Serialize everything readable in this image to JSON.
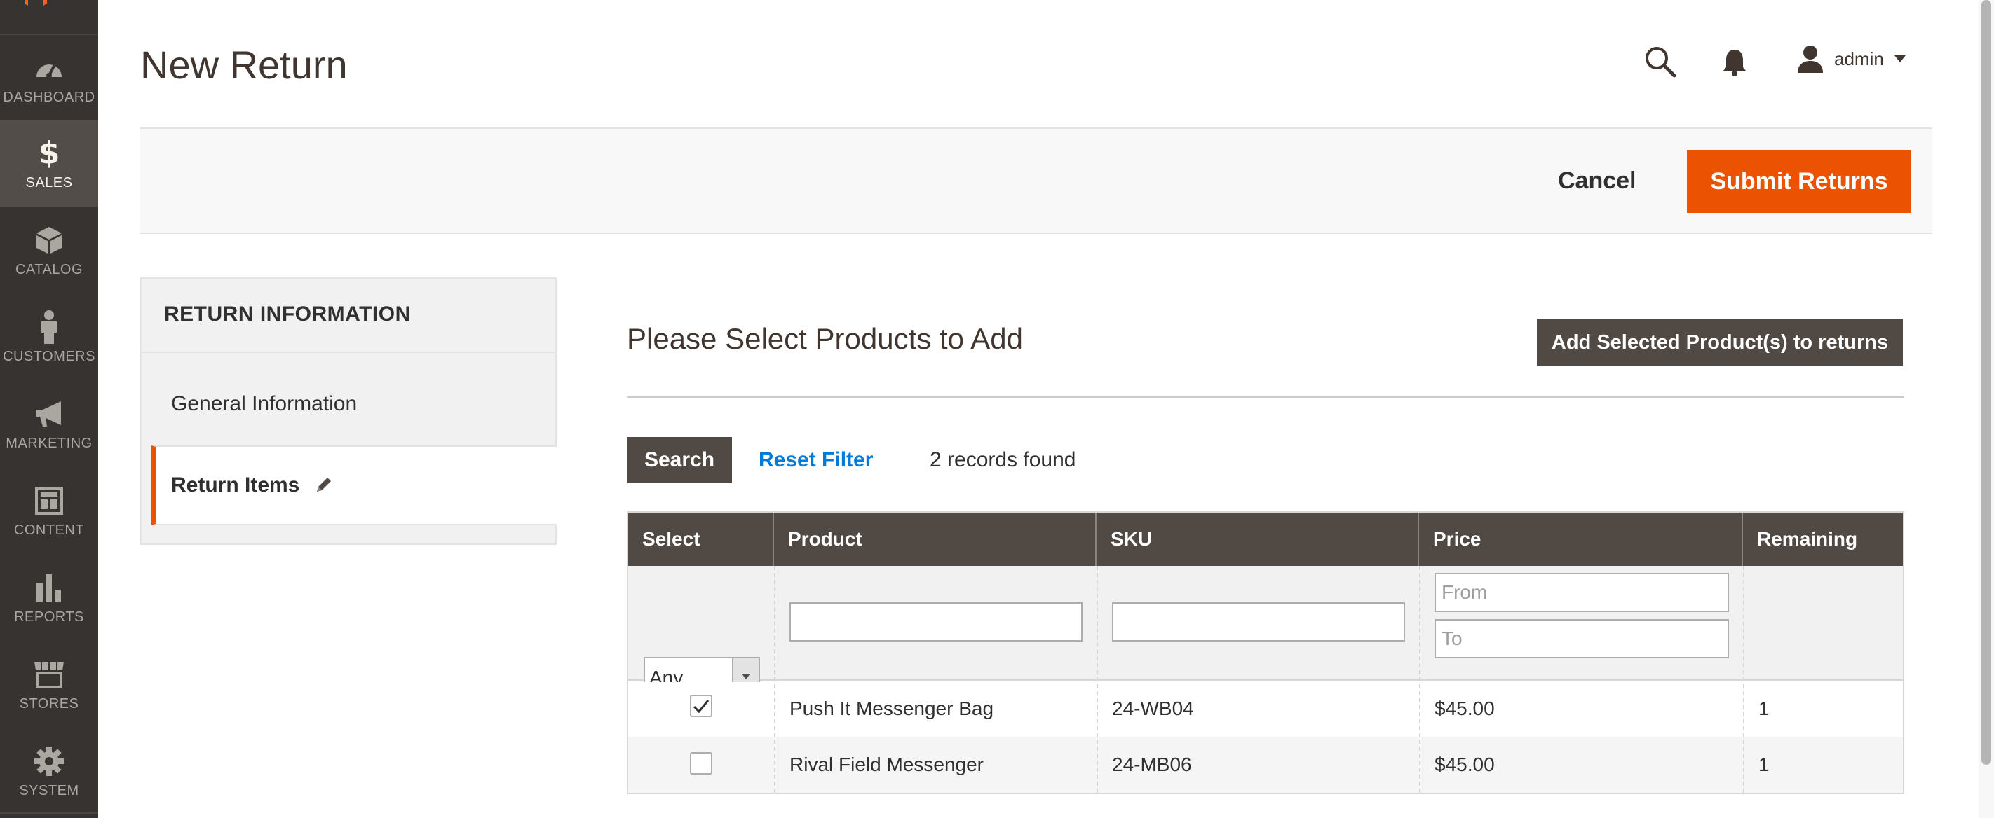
{
  "header": {
    "page_title": "New Return",
    "user_name": "admin"
  },
  "sidebar": {
    "items": [
      {
        "label": "DASHBOARD",
        "icon": "dashboard-icon"
      },
      {
        "label": "SALES",
        "icon": "dollar-icon",
        "active": true
      },
      {
        "label": "CATALOG",
        "icon": "cube-icon"
      },
      {
        "label": "CUSTOMERS",
        "icon": "person-icon"
      },
      {
        "label": "MARKETING",
        "icon": "megaphone-icon"
      },
      {
        "label": "CONTENT",
        "icon": "layout-icon"
      },
      {
        "label": "REPORTS",
        "icon": "bar-chart-icon"
      },
      {
        "label": "STORES",
        "icon": "store-icon"
      },
      {
        "label": "SYSTEM",
        "icon": "gear-icon"
      }
    ]
  },
  "actions": {
    "cancel_label": "Cancel",
    "submit_label": "Submit Returns"
  },
  "tabs": {
    "title": "RETURN INFORMATION",
    "general_label": "General Information",
    "return_items_label": "Return Items"
  },
  "main": {
    "section_title": "Please Select Products to Add",
    "add_button_label": "Add Selected Product(s) to returns",
    "search_label": "Search",
    "reset_filter_label": "Reset Filter",
    "records_text": "2 records found"
  },
  "grid": {
    "columns": [
      "Select",
      "Product",
      "SKU",
      "Price",
      "Remaining"
    ],
    "filters": {
      "select_value": "Any",
      "price_from_placeholder": "From",
      "price_to_placeholder": "To"
    },
    "rows": [
      {
        "checked": true,
        "product": "Push It Messenger Bag",
        "sku": "24-WB04",
        "price": "$45.00",
        "remaining": "1"
      },
      {
        "checked": false,
        "product": "Rival Field Messenger",
        "sku": "24-MB06",
        "price": "$45.00",
        "remaining": "1"
      }
    ]
  },
  "colors": {
    "sidebar_bg": "#373330",
    "accent_orange": "#eb5202",
    "dark_button": "#514943",
    "link_blue": "#007bdb"
  }
}
